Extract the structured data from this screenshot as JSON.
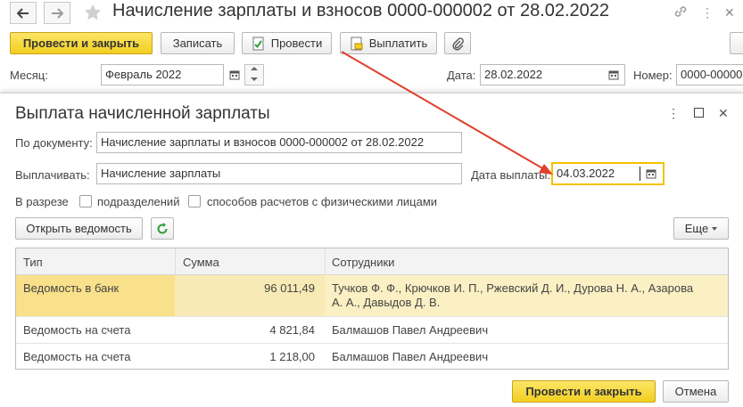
{
  "window": {
    "title": "Начисление зарплаты и взносов 0000-000002 от 28.02.2022",
    "back_icon": "arrow-left-icon",
    "forward_icon": "arrow-right-icon"
  },
  "toolbar": {
    "post_close": "Провести и закрыть",
    "save": "Записать",
    "post": "Провести",
    "pay": "Выплатить"
  },
  "header_fields": {
    "month_label": "Месяц:",
    "month_value": "Февраль 2022",
    "date_label": "Дата:",
    "date_value": "28.02.2022",
    "number_label": "Номер:",
    "number_value": "0000-00000"
  },
  "dialog": {
    "title": "Выплата начисленной зарплаты",
    "by_doc_label": "По документу:",
    "by_doc_value": "Начисление зарплаты и взносов 0000-000002 от 28.02.2022",
    "pay_label": "Выплачивать:",
    "pay_value": "Начисление зарплаты",
    "pay_date_label": "Дата выплаты:",
    "pay_date_value": "04.03.2022",
    "breakdown_label": "В разрезе",
    "cb_departments": "подразделений",
    "cb_methods": "способов расчетов с физическими лицами",
    "open_statement": "Открыть ведомость",
    "more": "Еще",
    "columns": [
      "Тип",
      "Сумма",
      "Сотрудники"
    ],
    "rows": [
      {
        "type": "Ведомость в банк",
        "sum": "96 011,49",
        "staff_1": "Тучков Ф. Ф., Крючков И. П., Ржевский Д. И., Дурова Н. А., Азарова",
        "staff_2": "А. А., Давыдов Д. В."
      },
      {
        "type": "Ведомость на счета",
        "sum": "4 821,84",
        "staff_1": "Балмашов Павел Андреевич",
        "staff_2": ""
      },
      {
        "type": "Ведомость на счета",
        "sum": "1 218,00",
        "staff_1": "Балмашов Павел Андреевич",
        "staff_2": ""
      }
    ],
    "ok_button": "Провести и закрыть",
    "cancel_button": "Отмена"
  },
  "colors": {
    "accent_yellow": "#f5d631",
    "selected_row": "#fbf0c3",
    "selected_cell": "#f9e08a",
    "annotation_arrow": "#e0402b",
    "refresh_green": "#2e9e3a"
  }
}
